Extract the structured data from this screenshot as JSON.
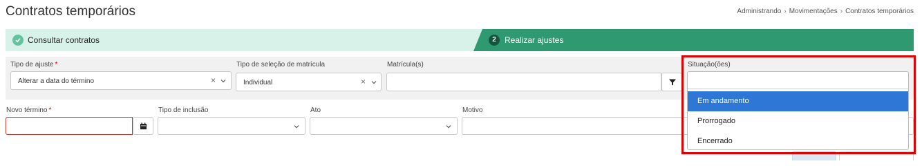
{
  "page": {
    "title": "Contratos temporários"
  },
  "breadcrumb": [
    "Administrando",
    "Movimentações",
    "Contratos temporários"
  ],
  "steps": [
    {
      "number": "",
      "label": "Consultar contratos",
      "state": "done"
    },
    {
      "number": "2",
      "label": "Realizar ajustes",
      "state": "active"
    }
  ],
  "filters": {
    "tipo_ajuste": {
      "label": "Tipo de ajuste",
      "required_mark": "*",
      "value": "Alterar a data do término"
    },
    "tipo_selecao": {
      "label": "Tipo de seleção de matrícula",
      "value": "Individual"
    },
    "matriculas": {
      "label": "Matrícula(s)",
      "value": ""
    },
    "situacoes": {
      "label": "Situação(ões)",
      "search_value": "",
      "options": [
        "Em andamento",
        "Prorrogado",
        "Encerrado"
      ],
      "highlighted": "Em andamento"
    }
  },
  "form": {
    "novo_termino": {
      "label": "Novo término",
      "required_mark": "*",
      "value": ""
    },
    "tipo_inclusao": {
      "label": "Tipo de inclusão",
      "value": ""
    },
    "ato": {
      "label": "Ato",
      "value": ""
    },
    "motivo": {
      "label": "Motivo",
      "value": ""
    }
  },
  "colors": {
    "accent_green": "#2f9a72",
    "step_done_bg": "#d8f2e9",
    "selection_blue": "#2f77d6",
    "highlight_red": "#e00000"
  }
}
